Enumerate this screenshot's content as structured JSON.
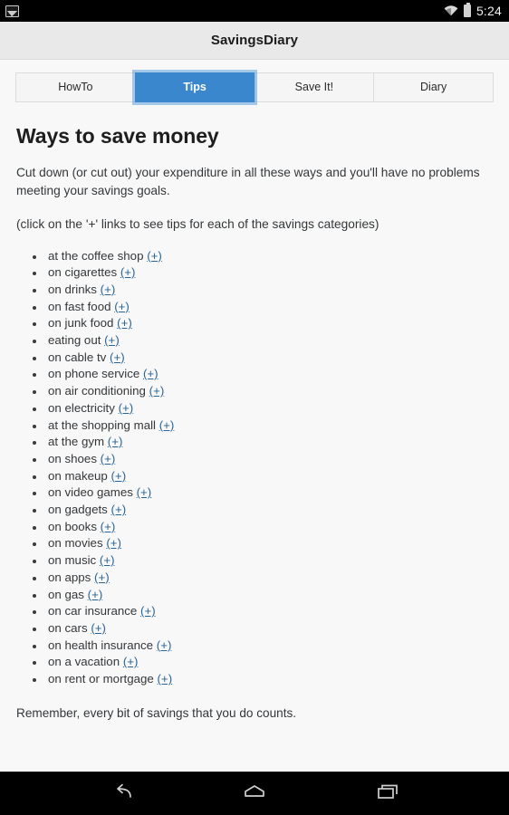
{
  "status_bar": {
    "notification_icon": "image-notification-icon",
    "wifi_icon": "wifi-icon",
    "battery_icon": "battery-icon",
    "time": "5:24"
  },
  "header": {
    "title": "SavingsDiary"
  },
  "tabs": [
    {
      "label": "HowTo",
      "active": false
    },
    {
      "label": "Tips",
      "active": true
    },
    {
      "label": "Save It!",
      "active": false
    },
    {
      "label": "Diary",
      "active": false
    }
  ],
  "main": {
    "page_title": "Ways to save money",
    "paragraph_1": "Cut down (or cut out) your expenditure in all these ways and you'll have no problems meeting your savings goals.",
    "paragraph_2": "(click on the '+' links to see tips for each of the savings categories)",
    "link_label": "(+)",
    "tips": [
      "at the coffee shop",
      "on cigarettes",
      "on drinks",
      "on fast food",
      "on junk food",
      "eating out",
      "on cable tv",
      "on phone service",
      "on air conditioning",
      "on electricity",
      "at the shopping mall",
      "at the gym",
      "on shoes",
      "on makeup",
      "on video games",
      "on gadgets",
      "on books",
      "on movies",
      "on music",
      "on apps",
      "on gas",
      "on car insurance",
      "on cars",
      "on health insurance",
      "on a vacation",
      "on rent or mortgage"
    ],
    "closing": "Remember, every bit of savings that you do counts."
  },
  "nav_bar": {
    "back": "back-icon",
    "home": "home-icon",
    "recents": "recents-icon"
  },
  "colors": {
    "accent": "#3a87cd",
    "link": "#2a6496",
    "header_bg": "#e9e9e9",
    "content_bg": "#f8f8f8",
    "system_bg": "#000000"
  }
}
